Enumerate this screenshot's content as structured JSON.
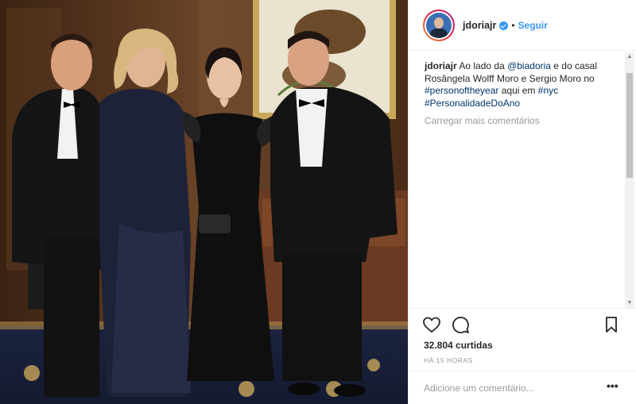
{
  "post": {
    "username": "jdoriajr",
    "follow_label": "Seguir",
    "dot": "•"
  },
  "caption": {
    "user": "jdoriajr",
    "text_1": " Ao lado da ",
    "mention": "@biadoria",
    "text_2": " e do casal Rosângela Wolff Moro e Sergio Moro no ",
    "hashtag_1": "#personoftheyear",
    "text_3": " aqui em ",
    "hashtag_2": "#nyc",
    "hashtag_3": "#PersonalidadeDoAno"
  },
  "load_more_label": "Carregar mais comentários",
  "likes_text": "32.804 curtidas",
  "time_text": "HÁ 15 HORAS",
  "comment_placeholder": "Adicione um comentário...",
  "more_label": "•••",
  "icons": {
    "like": "heart-icon",
    "comment": "comment-icon",
    "save": "bookmark-icon",
    "verified": "verified-icon"
  },
  "colors": {
    "accent": "#3897f0",
    "link": "#003569",
    "muted": "#999999"
  }
}
